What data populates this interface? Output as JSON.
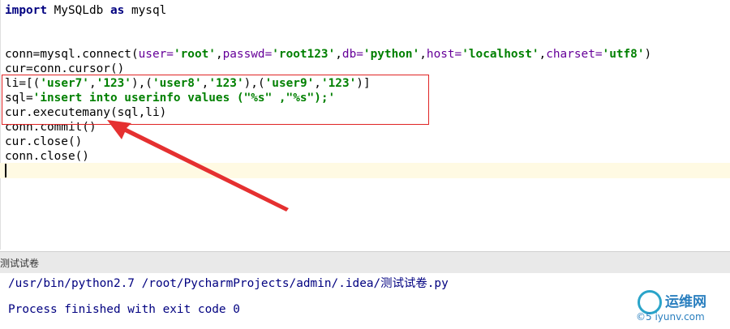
{
  "editor": {
    "lines": [
      [
        {
          "t": "import",
          "c": "kw"
        },
        {
          "t": " MySQLdb ",
          "c": ""
        },
        {
          "t": "as",
          "c": "kw"
        },
        {
          "t": " mysql",
          "c": ""
        }
      ],
      [],
      [],
      [
        {
          "t": "conn=mysql.connect(",
          "c": ""
        },
        {
          "t": "user=",
          "c": "param"
        },
        {
          "t": "'root'",
          "c": "str"
        },
        {
          "t": ",",
          "c": ""
        },
        {
          "t": "passwd=",
          "c": "param"
        },
        {
          "t": "'root123'",
          "c": "str"
        },
        {
          "t": ",",
          "c": ""
        },
        {
          "t": "db=",
          "c": "param"
        },
        {
          "t": "'python'",
          "c": "str"
        },
        {
          "t": ",",
          "c": ""
        },
        {
          "t": "host=",
          "c": "param"
        },
        {
          "t": "'localhost'",
          "c": "str"
        },
        {
          "t": ",",
          "c": ""
        },
        {
          "t": "charset=",
          "c": "param"
        },
        {
          "t": "'utf8'",
          "c": "str"
        },
        {
          "t": ")",
          "c": ""
        }
      ],
      [
        {
          "t": "cur=conn.cursor()",
          "c": ""
        }
      ],
      [
        {
          "t": "li=[(",
          "c": ""
        },
        {
          "t": "'user7'",
          "c": "str"
        },
        {
          "t": ",",
          "c": ""
        },
        {
          "t": "'123'",
          "c": "str"
        },
        {
          "t": "),(",
          "c": ""
        },
        {
          "t": "'user8'",
          "c": "str"
        },
        {
          "t": ",",
          "c": ""
        },
        {
          "t": "'123'",
          "c": "str"
        },
        {
          "t": "),(",
          "c": ""
        },
        {
          "t": "'user9'",
          "c": "str"
        },
        {
          "t": ",",
          "c": ""
        },
        {
          "t": "'123'",
          "c": "str"
        },
        {
          "t": ")]",
          "c": ""
        }
      ],
      [
        {
          "t": "sql=",
          "c": ""
        },
        {
          "t": "'insert into userinfo values (\"%s\" ,\"%s\");'",
          "c": "str"
        }
      ],
      [
        {
          "t": "cur.executemany(sql,li)",
          "c": ""
        }
      ],
      [
        {
          "t": "conn.commit()",
          "c": ""
        }
      ],
      [
        {
          "t": "cur.close()",
          "c": ""
        }
      ],
      [
        {
          "t": "conn.close()",
          "c": ""
        }
      ]
    ]
  },
  "run_panel": {
    "title": "测试试卷"
  },
  "console": {
    "command": "/usr/bin/python2.7 /root/PycharmProjects/admin/.idea/测试试卷.py",
    "result": "Process finished with exit code 0"
  },
  "watermark": {
    "line1": "运维网",
    "line2": "©5 iyunv.com"
  },
  "colors": {
    "keyword": "#000080",
    "string": "#008000",
    "param": "#660099",
    "highlight_box": "#e02424",
    "current_line": "#fffae3"
  }
}
